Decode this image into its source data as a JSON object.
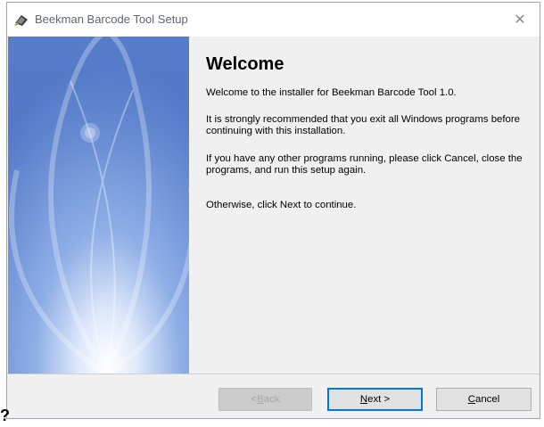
{
  "window": {
    "title": "Beekman Barcode Tool Setup",
    "close_glyph": "✕"
  },
  "content": {
    "heading": "Welcome",
    "paragraphs": [
      "Welcome to the installer for Beekman Barcode Tool 1.0.",
      "It is strongly recommended that you exit all Windows programs before continuing with this installation.",
      "If you have any other programs running, please click Cancel, close the programs, and run this setup again.",
      "Otherwise, click Next to continue."
    ]
  },
  "buttons": {
    "back": {
      "prefix": "< ",
      "mnemonic": "B",
      "rest": "ack",
      "enabled": false
    },
    "next": {
      "mnemonic": "N",
      "rest": "ext >",
      "enabled": true,
      "default": true
    },
    "cancel": {
      "mnemonic": "C",
      "rest": "ancel",
      "enabled": true
    }
  },
  "colors": {
    "side_panel": "#4f76c6",
    "accent": "#0078d7"
  },
  "icons": {
    "app": "setup-installer-icon",
    "close": "close-icon"
  }
}
